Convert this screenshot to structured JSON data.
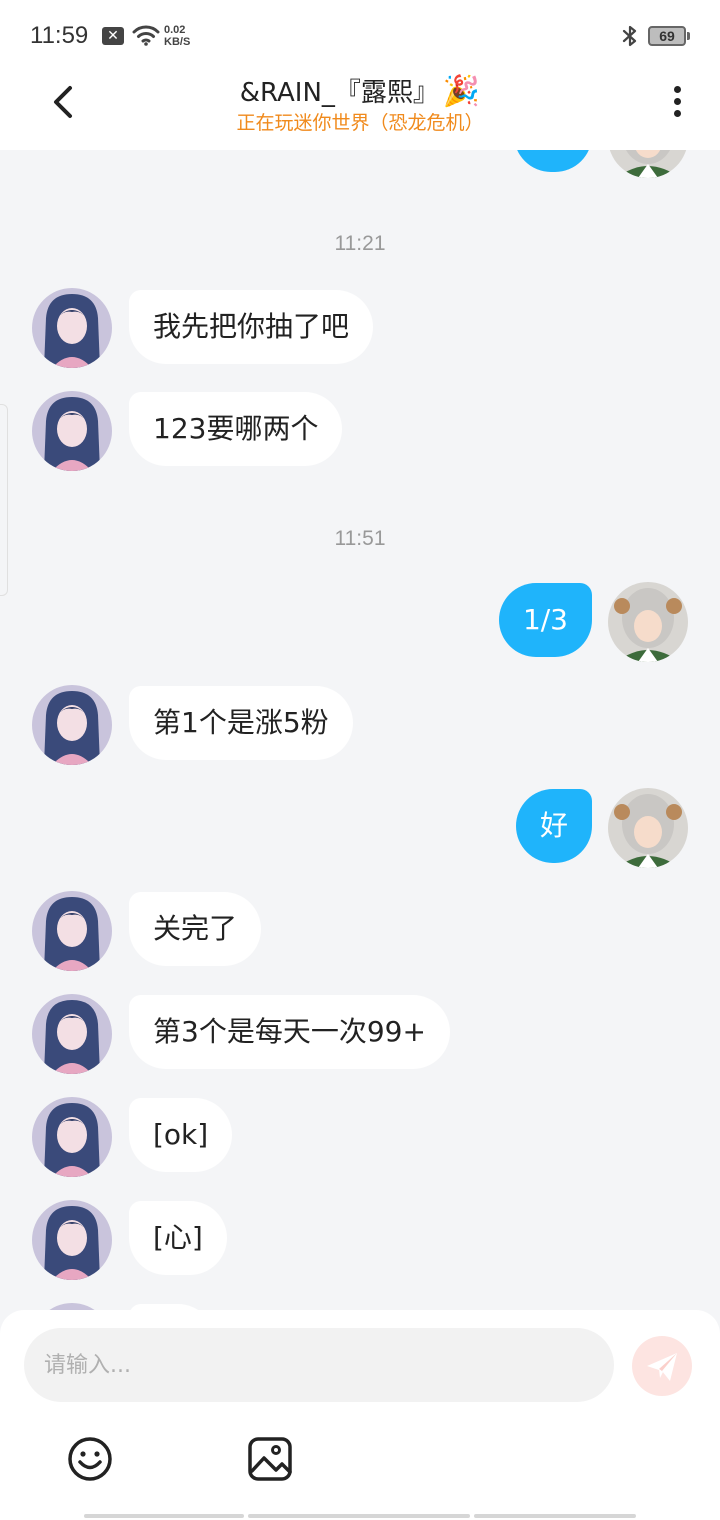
{
  "status_bar": {
    "time": "11:59",
    "notification_icon": "x-box-icon",
    "net_speed_value": "0.02",
    "net_speed_unit": "KB/S",
    "battery": "69"
  },
  "header": {
    "title": "&RAIN_『露熙』",
    "title_emoji": "🎉",
    "subtitle": "正在玩迷你世界（恐龙危机）",
    "back_icon": "chevron-left-icon",
    "more_icon": "more-vertical-icon"
  },
  "colors": {
    "accent_blue": "#1fb4fb",
    "subtitle_orange": "#f08a1c",
    "background": "#f4f5f7",
    "send_button_inactive": "#fde4e1"
  },
  "messages": {
    "time_1": "11:21",
    "m1": "我先把你抽了吧",
    "m2": "123要哪两个",
    "time_2": "11:51",
    "m3": "1/3",
    "m4": "第1个是涨5粉",
    "m5": "好",
    "m6": "关完了",
    "m7": "第3个是每天一次99+",
    "m8": "[ok]",
    "m9": "[心]"
  },
  "composer": {
    "placeholder": "请输入...",
    "send_icon": "paper-plane-icon",
    "emoji_icon": "smiley-icon",
    "image_icon": "image-icon"
  }
}
